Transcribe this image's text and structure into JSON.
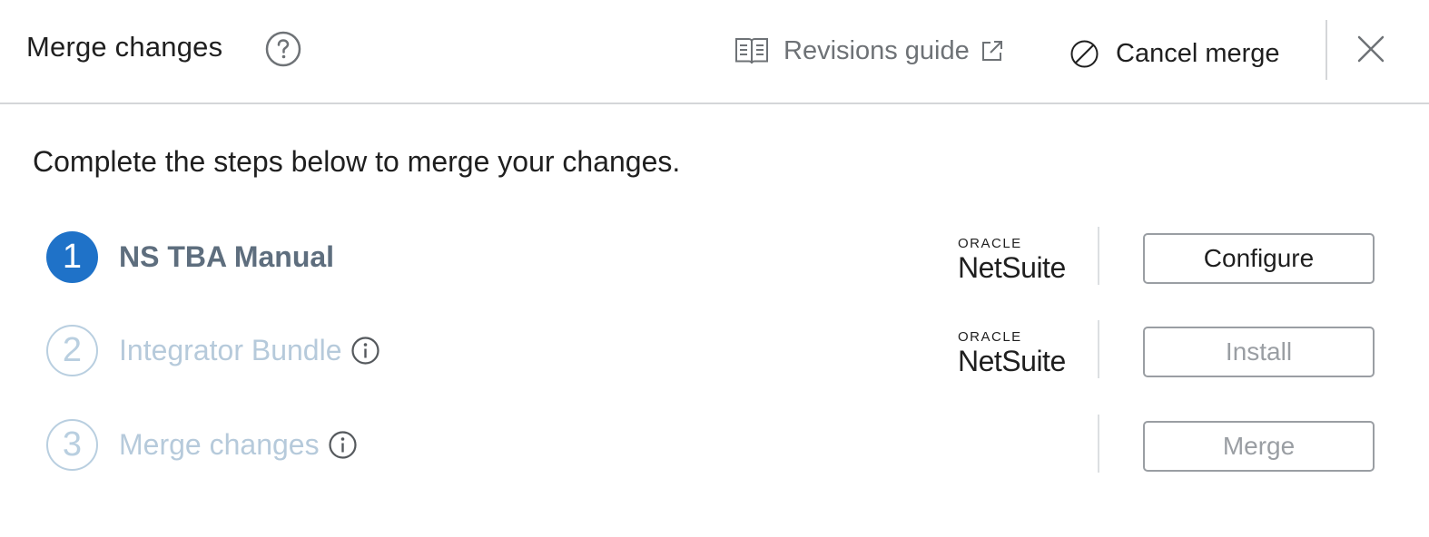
{
  "header": {
    "title": "Merge changes",
    "help_icon": "question-circle-icon",
    "guide_label": "Revisions guide",
    "guide_icon": "book-icon",
    "external_icon": "external-link-icon",
    "cancel_label": "Cancel merge",
    "cancel_icon": "ban-icon",
    "close_icon": "close-icon"
  },
  "intro": "Complete the steps below to merge your changes.",
  "steps": [
    {
      "number": "1",
      "label": "NS TBA Manual",
      "state": "active",
      "logo_top": "ORACLE",
      "logo_bottom": "NetSuite",
      "button": "Configure"
    },
    {
      "number": "2",
      "label": "Integrator Bundle",
      "state": "inactive",
      "logo_top": "ORACLE",
      "logo_bottom": "NetSuite",
      "button": "Install"
    },
    {
      "number": "3",
      "label": "Merge changes",
      "state": "inactive",
      "button": "Merge"
    }
  ],
  "colors": {
    "accent": "#1f72c8",
    "inactive_step": "#b6cadb",
    "active_label": "#5e6e7e",
    "border": "#d4d6d9",
    "disabled_text": "#9a9ea3"
  }
}
